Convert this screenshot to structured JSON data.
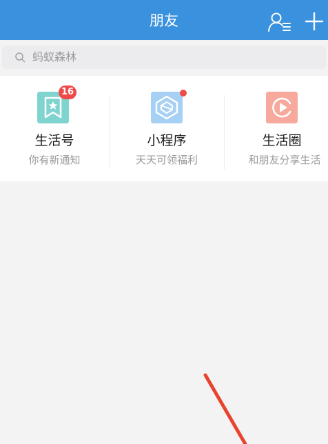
{
  "header": {
    "title": "朋友",
    "contacts_icon": "contacts-list-icon",
    "add_icon": "plus-icon",
    "background": "#3a91de"
  },
  "search": {
    "placeholder": "蚂蚁森林",
    "icon": "search-icon"
  },
  "features": [
    {
      "label": "生活号",
      "subtitle": "你有新通知",
      "icon": "bookmark-star-icon",
      "icon_color": "#7fd4d0",
      "badge": "16"
    },
    {
      "label": "小程序",
      "subtitle": "天天可领福利",
      "icon": "cube-icon",
      "icon_color": "#a7d1f4",
      "dot_color": "#ef4a47"
    },
    {
      "label": "生活圈",
      "subtitle": "和朋友分享生活",
      "icon": "play-circle-icon",
      "icon_color": "#f6a99c"
    }
  ],
  "annotation": {
    "color": "#e8432e",
    "shape": "arrow"
  }
}
